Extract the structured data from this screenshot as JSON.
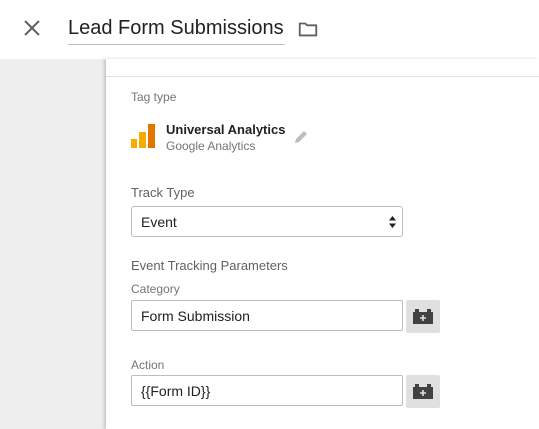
{
  "header": {
    "title": "Lead Form Submissions"
  },
  "tag_type": {
    "label": "Tag type",
    "name": "Universal Analytics",
    "vendor": "Google Analytics",
    "logo_colors": [
      "#f9ab00",
      "#e37400"
    ]
  },
  "track_type": {
    "label": "Track Type",
    "selected": "Event"
  },
  "event_params": {
    "heading": "Event Tracking Parameters",
    "category": {
      "label": "Category",
      "value": "Form Submission"
    },
    "action": {
      "label": "Action",
      "value": "{{Form ID}}"
    }
  },
  "icons": {
    "close": "close-icon",
    "folder": "folder-icon",
    "edit": "pencil-icon",
    "variable": "variable-brick-icon"
  }
}
